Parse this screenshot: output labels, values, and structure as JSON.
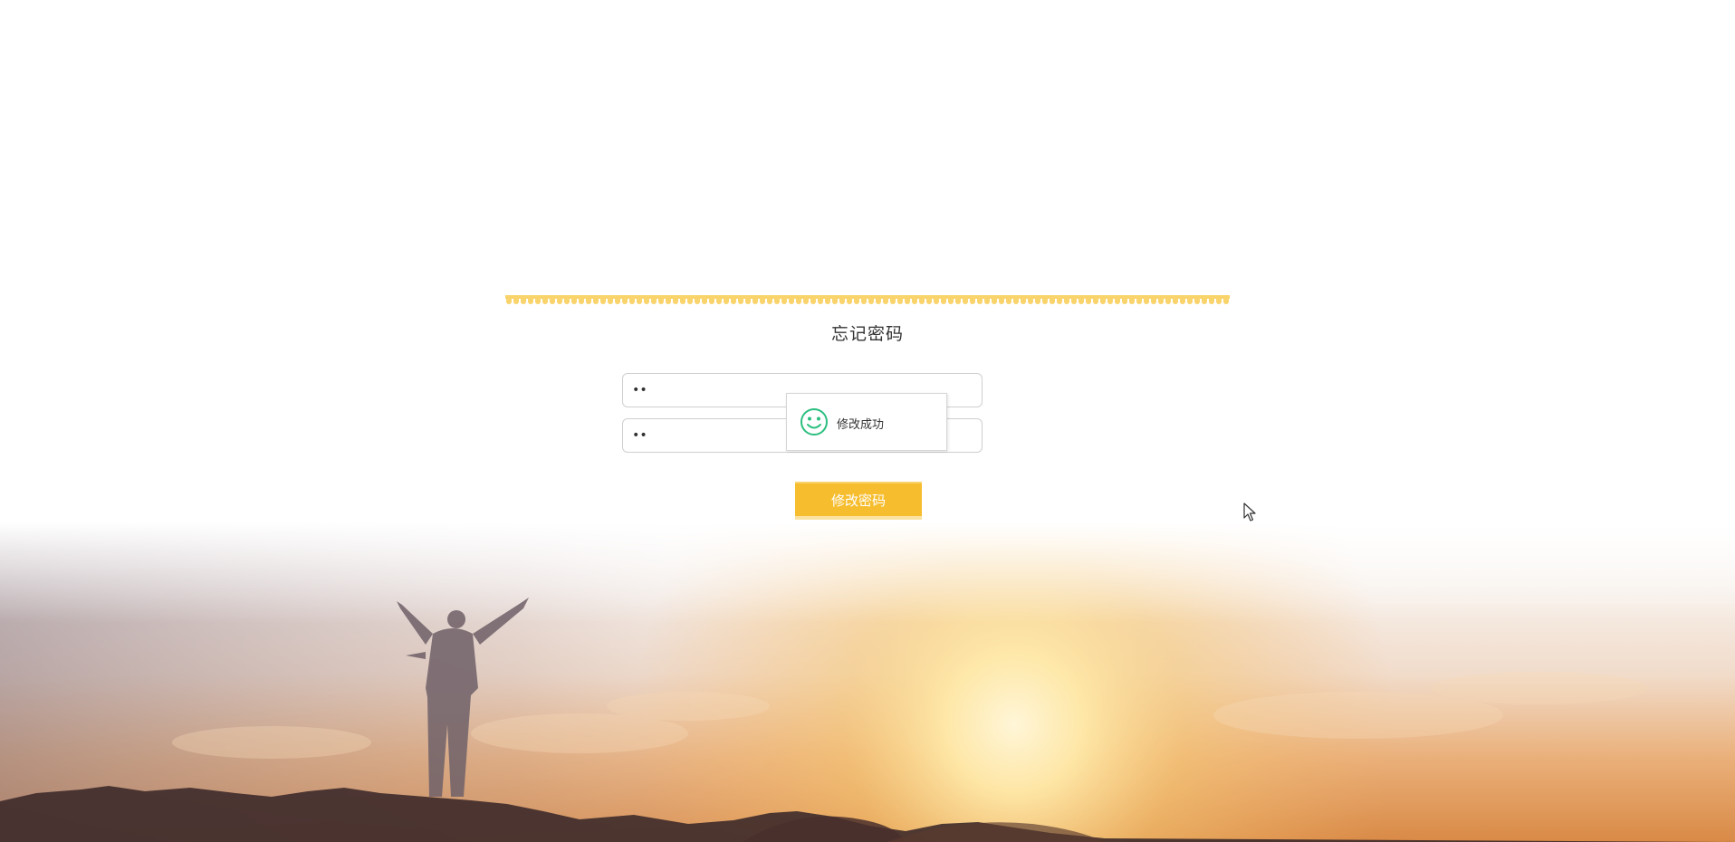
{
  "page": {
    "title": "忘记密码"
  },
  "form": {
    "password_value": "••",
    "confirm_password_value": "••",
    "submit_label": "修改密码"
  },
  "toast": {
    "icon": "smile-icon",
    "message": "修改成功"
  },
  "colors": {
    "accent": "#f6bd2f",
    "success": "#2bbf7f",
    "zigzag": "#f9d36b"
  }
}
